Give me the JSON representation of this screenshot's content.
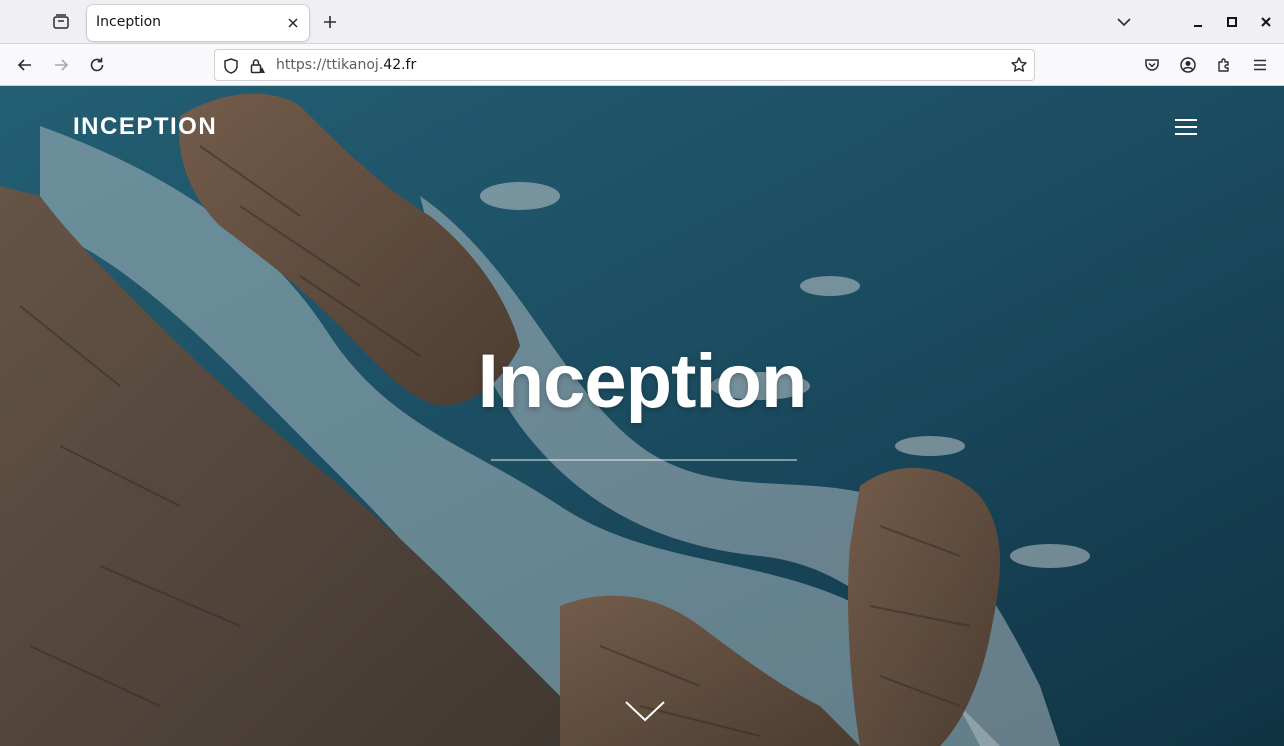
{
  "browser": {
    "tab": {
      "title": "Inception"
    },
    "url": {
      "prefix": "https://ttikanoj.",
      "domain": "42.fr"
    },
    "icons": {
      "tab_overview": "tab-overview-icon",
      "close_tab": "close-icon",
      "new_tab": "plus-icon",
      "list_tabs": "chevron-down-icon",
      "minimize": "minimize-icon",
      "maximize": "maximize-icon",
      "close_window": "close-window-icon",
      "back": "back-arrow-icon",
      "forward": "forward-arrow-icon",
      "reload": "reload-icon",
      "tracking_protection": "shield-icon",
      "site_security": "lock-icon",
      "bookmark": "star-icon",
      "pocket": "pocket-icon",
      "account": "account-icon",
      "extensions": "puzzle-icon",
      "app_menu": "hamburger-menu-icon"
    }
  },
  "page": {
    "logo": "INCEPTION",
    "hero_title": "Inception",
    "icons": {
      "menu": "hamburger-menu-icon",
      "scroll": "chevron-down-icon"
    },
    "colors": {
      "text": "#ffffff",
      "sea": "#1c4a5e",
      "rock": "#6b5a4c"
    }
  }
}
